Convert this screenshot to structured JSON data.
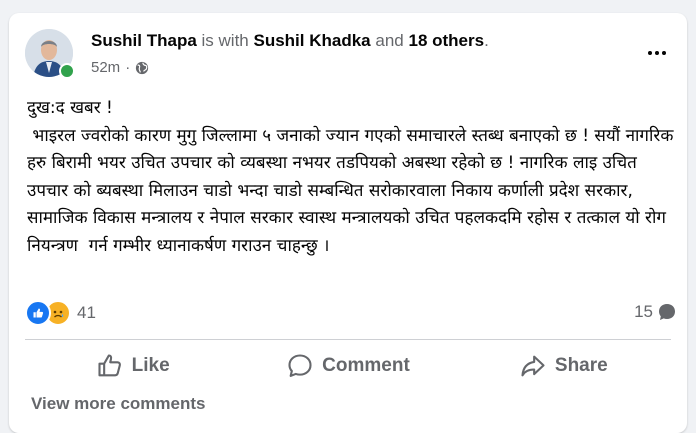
{
  "post": {
    "author": "Sushil Thapa",
    "with_text": "is with",
    "tagged_person": "Sushil Khadka",
    "and_text": "and",
    "others": "18 others",
    "period": ".",
    "time": "52m",
    "separator": "·",
    "privacy_icon": "globe-icon",
    "body": "दुख:द खबर !\n भाइरल ज्वरोको कारण मुगु जिल्लामा ५ जनाको ज्यान गएको समाचारले स्तब्ध बनाएको छ ! सयौं नागरिक हरु बिरामी भयर उचित उपचार को व्यबस्था नभयर तडपियको अबस्था रहेको छ ! नागरिक लाइ उचित उपचार को ब्यबस्था मिलाउन चाडो भन्दा चाडो सम्बन्धित सरोकारवाला निकाय कर्णाली प्रदेश सरकार, सामाजिक विकास मन्त्रालय र नेपाल सरकार स्वास्थ मन्त्रालयको उचित पहलकदमि रहोस र तत्काल यो रोग नियन्त्रण  गर्न गम्भीर ध्यानाकर्षण गराउन चाहन्छु ।"
  },
  "reactions": {
    "count": "41",
    "types": [
      "like-icon",
      "sad-icon"
    ]
  },
  "comments": {
    "count": "15"
  },
  "actions": {
    "like": "Like",
    "comment": "Comment",
    "share": "Share"
  },
  "footer": {
    "view_more": "View more comments"
  },
  "colors": {
    "like_blue": "#1877f2",
    "sad_yellow": "#f7b125",
    "online_green": "#31a24c",
    "secondary_text": "#65676b"
  }
}
